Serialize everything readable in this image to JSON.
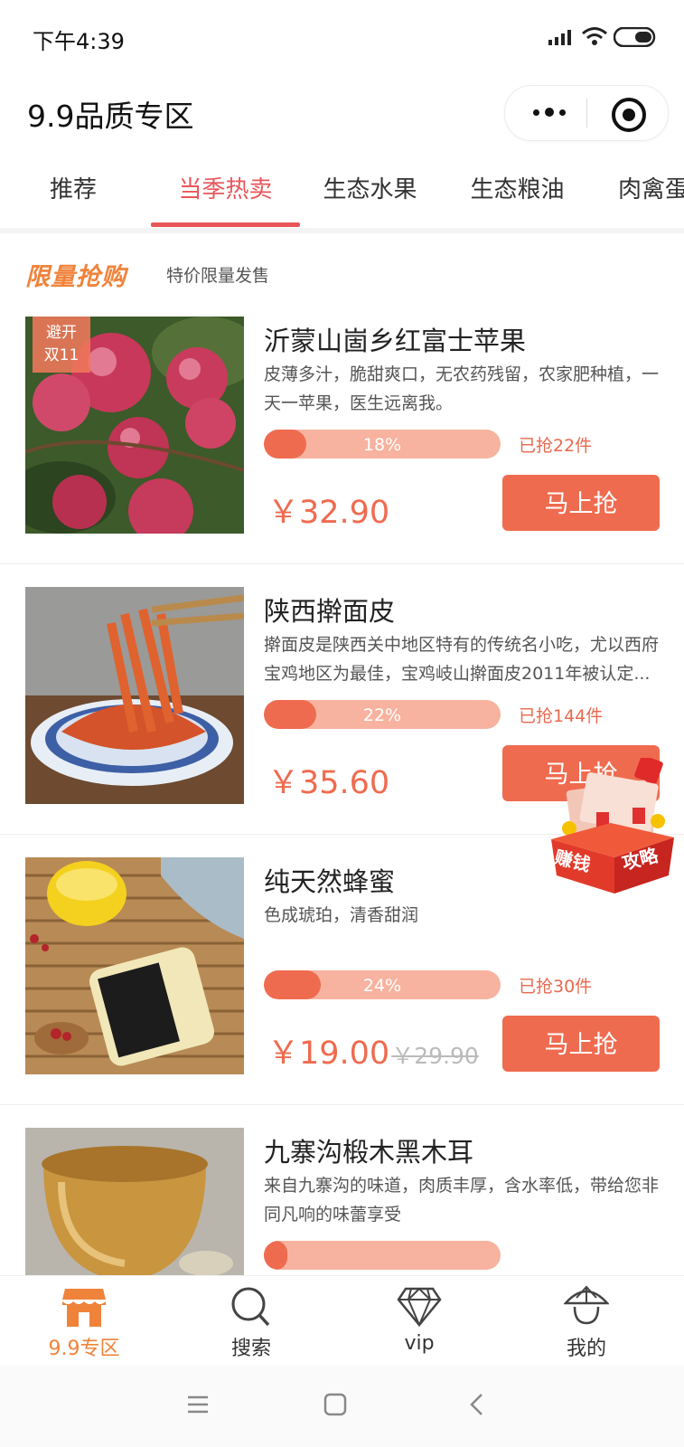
{
  "status": {
    "time": "下午4:39"
  },
  "header": {
    "title": "9.9品质专区"
  },
  "tabs": [
    {
      "label": "推荐"
    },
    {
      "label": "当季热卖"
    },
    {
      "label": "生态水果"
    },
    {
      "label": "生态粮油"
    },
    {
      "label": "肉禽蛋"
    }
  ],
  "section": {
    "title": "限量抢购",
    "subtitle": "特价限量发售"
  },
  "products": [
    {
      "title": "沂蒙山崮乡红富士苹果",
      "desc": "皮薄多汁，脆甜爽口，无农药残留，农家肥种植，一天一苹果，医生远离我。",
      "progress": 18,
      "progress_text": "18%",
      "sold": "已抢22件",
      "price": "￥32.90",
      "old_price": "",
      "button": "马上抢",
      "badge_line1": "避开",
      "badge_line2": "双11"
    },
    {
      "title": "陕西擀面皮",
      "desc": "擀面皮是陕西关中地区特有的传统名小吃，尤以西府宝鸡地区为最佳，宝鸡岐山擀面皮2011年被认定...",
      "progress": 22,
      "progress_text": "22%",
      "sold": "已抢144件",
      "price": "￥35.60",
      "old_price": "",
      "button": "马上抢"
    },
    {
      "title": "纯天然蜂蜜",
      "desc": "色成琥珀，清香甜润",
      "progress": 24,
      "progress_text": "24%",
      "sold": "已抢30件",
      "price": "￥19.00",
      "old_price": "￥29.90",
      "button": "马上抢"
    },
    {
      "title": "九寨沟椴木黑木耳",
      "desc": "来自九寨沟的味道，肉质丰厚，含水率低，带给您非同凡响的味蕾享受",
      "progress": 10,
      "progress_text": "",
      "sold": "",
      "price": "",
      "old_price": "",
      "button": ""
    }
  ],
  "promo": {
    "left": "赚钱",
    "right": "攻略"
  },
  "bottom_nav": [
    {
      "label": "9.9专区",
      "icon": "shop-icon",
      "active": true
    },
    {
      "label": "搜索",
      "icon": "search-icon"
    },
    {
      "label": "vip",
      "icon": "diamond-icon"
    },
    {
      "label": "我的",
      "icon": "profile-hat-icon"
    }
  ],
  "colors": {
    "accent": "#ef6b4f",
    "tab_active": "#e8565a",
    "section": "#f0833a"
  }
}
